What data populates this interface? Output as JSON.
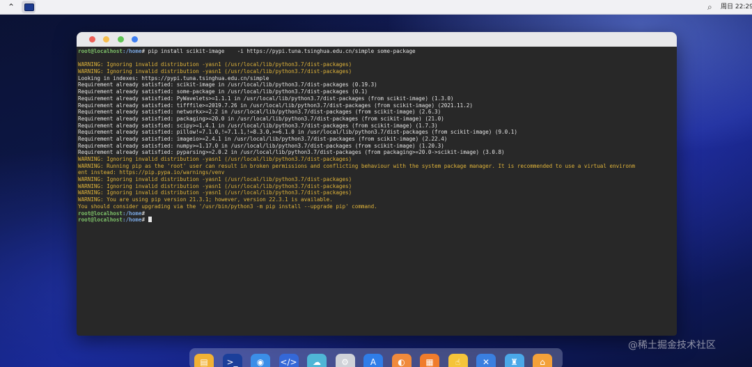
{
  "topbar": {
    "launcher_glyph": "⌃",
    "search_glyph": "⌕",
    "clock": "周日 22:29"
  },
  "terminal": {
    "lines": [
      {
        "segments": [
          {
            "cls": "host",
            "text": "root@localhost"
          },
          {
            "cls": "path",
            "text": ":/home"
          },
          {
            "cls": "plain",
            "text": "# pip install scikit-image    -i https://pypi.tuna.tsinghua.edu.cn/simple some-package"
          }
        ]
      },
      {
        "segments": []
      },
      {
        "segments": [
          {
            "cls": "warn",
            "text": "WARNING: Ignoring invalid distribution -yasn1 (/usr/local/lib/python3.7/dist-packages)"
          }
        ]
      },
      {
        "segments": [
          {
            "cls": "warn",
            "text": "WARNING: Ignoring invalid distribution -yasn1 (/usr/local/lib/python3.7/dist-packages)"
          }
        ]
      },
      {
        "segments": [
          {
            "cls": "plain",
            "text": "Looking in indexes: https://pypi.tuna.tsinghua.edu.cn/simple"
          }
        ]
      },
      {
        "segments": [
          {
            "cls": "plain",
            "text": "Requirement already satisfied: scikit-image in /usr/local/lib/python3.7/dist-packages (0.19.3)"
          }
        ]
      },
      {
        "segments": [
          {
            "cls": "plain",
            "text": "Requirement already satisfied: some-package in /usr/local/lib/python3.7/dist-packages (0.1)"
          }
        ]
      },
      {
        "segments": [
          {
            "cls": "plain",
            "text": "Requirement already satisfied: PyWavelets>=1.1.1 in /usr/local/lib/python3.7/dist-packages (from scikit-image) (1.3.0)"
          }
        ]
      },
      {
        "segments": [
          {
            "cls": "plain",
            "text": "Requirement already satisfied: tifffile>=2019.7.26 in /usr/local/lib/python3.7/dist-packages (from scikit-image) (2021.11.2)"
          }
        ]
      },
      {
        "segments": [
          {
            "cls": "plain",
            "text": "Requirement already satisfied: networkx>=2.2 in /usr/local/lib/python3.7/dist-packages (from scikit-image) (2.6.3)"
          }
        ]
      },
      {
        "segments": [
          {
            "cls": "plain",
            "text": "Requirement already satisfied: packaging>=20.0 in /usr/local/lib/python3.7/dist-packages (from scikit-image) (21.0)"
          }
        ]
      },
      {
        "segments": [
          {
            "cls": "plain",
            "text": "Requirement already satisfied: scipy>=1.4.1 in /usr/local/lib/python3.7/dist-packages (from scikit-image) (1.7.3)"
          }
        ]
      },
      {
        "segments": [
          {
            "cls": "plain",
            "text": "Requirement already satisfied: pillow!=7.1.0,!=7.1.1,!=8.3.0,>=6.1.0 in /usr/local/lib/python3.7/dist-packages (from scikit-image) (9.0.1)"
          }
        ]
      },
      {
        "segments": [
          {
            "cls": "plain",
            "text": "Requirement already satisfied: imageio>=2.4.1 in /usr/local/lib/python3.7/dist-packages (from scikit-image) (2.22.4)"
          }
        ]
      },
      {
        "segments": [
          {
            "cls": "plain",
            "text": "Requirement already satisfied: numpy>=1.17.0 in /usr/local/lib/python3.7/dist-packages (from scikit-image) (1.20.3)"
          }
        ]
      },
      {
        "segments": [
          {
            "cls": "plain",
            "text": "Requirement already satisfied: pyparsing>=2.0.2 in /usr/local/lib/python3.7/dist-packages (from packaging>=20.0->scikit-image) (3.0.8)"
          }
        ]
      },
      {
        "segments": [
          {
            "cls": "warn",
            "text": "WARNING: Ignoring invalid distribution -yasn1 (/usr/local/lib/python3.7/dist-packages)"
          }
        ]
      },
      {
        "segments": [
          {
            "cls": "warn",
            "text": "WARNING: Running pip as the 'root' user can result in broken permissions and conflicting behaviour with the system package manager. It is recommended to use a virtual environm"
          }
        ]
      },
      {
        "segments": [
          {
            "cls": "warn",
            "text": "ent instead: https://pip.pypa.io/warnings/venv"
          }
        ]
      },
      {
        "segments": [
          {
            "cls": "warn",
            "text": "WARNING: Ignoring invalid distribution -yasn1 (/usr/local/lib/python3.7/dist-packages)"
          }
        ]
      },
      {
        "segments": [
          {
            "cls": "warn",
            "text": "WARNING: Ignoring invalid distribution -yasn1 (/usr/local/lib/python3.7/dist-packages)"
          }
        ]
      },
      {
        "segments": [
          {
            "cls": "warn",
            "text": "WARNING: Ignoring invalid distribution -yasn1 (/usr/local/lib/python3.7/dist-packages)"
          }
        ]
      },
      {
        "segments": [
          {
            "cls": "warn",
            "text": "WARNING: You are using pip version 21.3.1; however, version 22.3.1 is available."
          }
        ]
      },
      {
        "segments": [
          {
            "cls": "warn",
            "text": "You should consider upgrading via the '/usr/bin/python3 -m pip install --upgrade pip' command."
          }
        ]
      },
      {
        "segments": [
          {
            "cls": "host",
            "text": "root@localhost"
          },
          {
            "cls": "path",
            "text": ":/home"
          },
          {
            "cls": "plain",
            "text": "# "
          }
        ]
      },
      {
        "segments": [
          {
            "cls": "host",
            "text": "root@localhost"
          },
          {
            "cls": "path",
            "text": ":/home"
          },
          {
            "cls": "plain",
            "text": "# "
          }
        ],
        "cursor": true
      }
    ]
  },
  "dock": {
    "items": [
      {
        "name": "files-icon",
        "bg": "#f2b234",
        "glyph": "▤"
      },
      {
        "name": "terminal-app-icon",
        "bg": "#1b3f9a",
        "glyph": ">_"
      },
      {
        "name": "browser-icon",
        "bg": "#3b8ee8",
        "glyph": "◉"
      },
      {
        "name": "code-editor-icon",
        "bg": "#3468d8",
        "glyph": "</>"
      },
      {
        "name": "cloud-icon",
        "bg": "#4fb6d6",
        "glyph": "☁"
      },
      {
        "name": "settings-icon",
        "bg": "#cfd2d8",
        "glyph": "⚙"
      },
      {
        "name": "app-store-icon",
        "bg": "#2f7de8",
        "glyph": "A"
      },
      {
        "name": "tips-icon",
        "bg": "#f08a3c",
        "glyph": "◐"
      },
      {
        "name": "calculator-icon",
        "bg": "#f07c2c",
        "glyph": "▦"
      },
      {
        "name": "touch-icon",
        "bg": "#f5c43a",
        "glyph": "☝"
      },
      {
        "name": "tools-icon",
        "bg": "#3a7fe0",
        "glyph": "✕"
      },
      {
        "name": "clothes-icon",
        "bg": "#4aa8e8",
        "glyph": "♜"
      },
      {
        "name": "package-icon",
        "bg": "#f3a13a",
        "glyph": "⌂"
      }
    ]
  },
  "watermark": "@稀土掘金技术社区"
}
